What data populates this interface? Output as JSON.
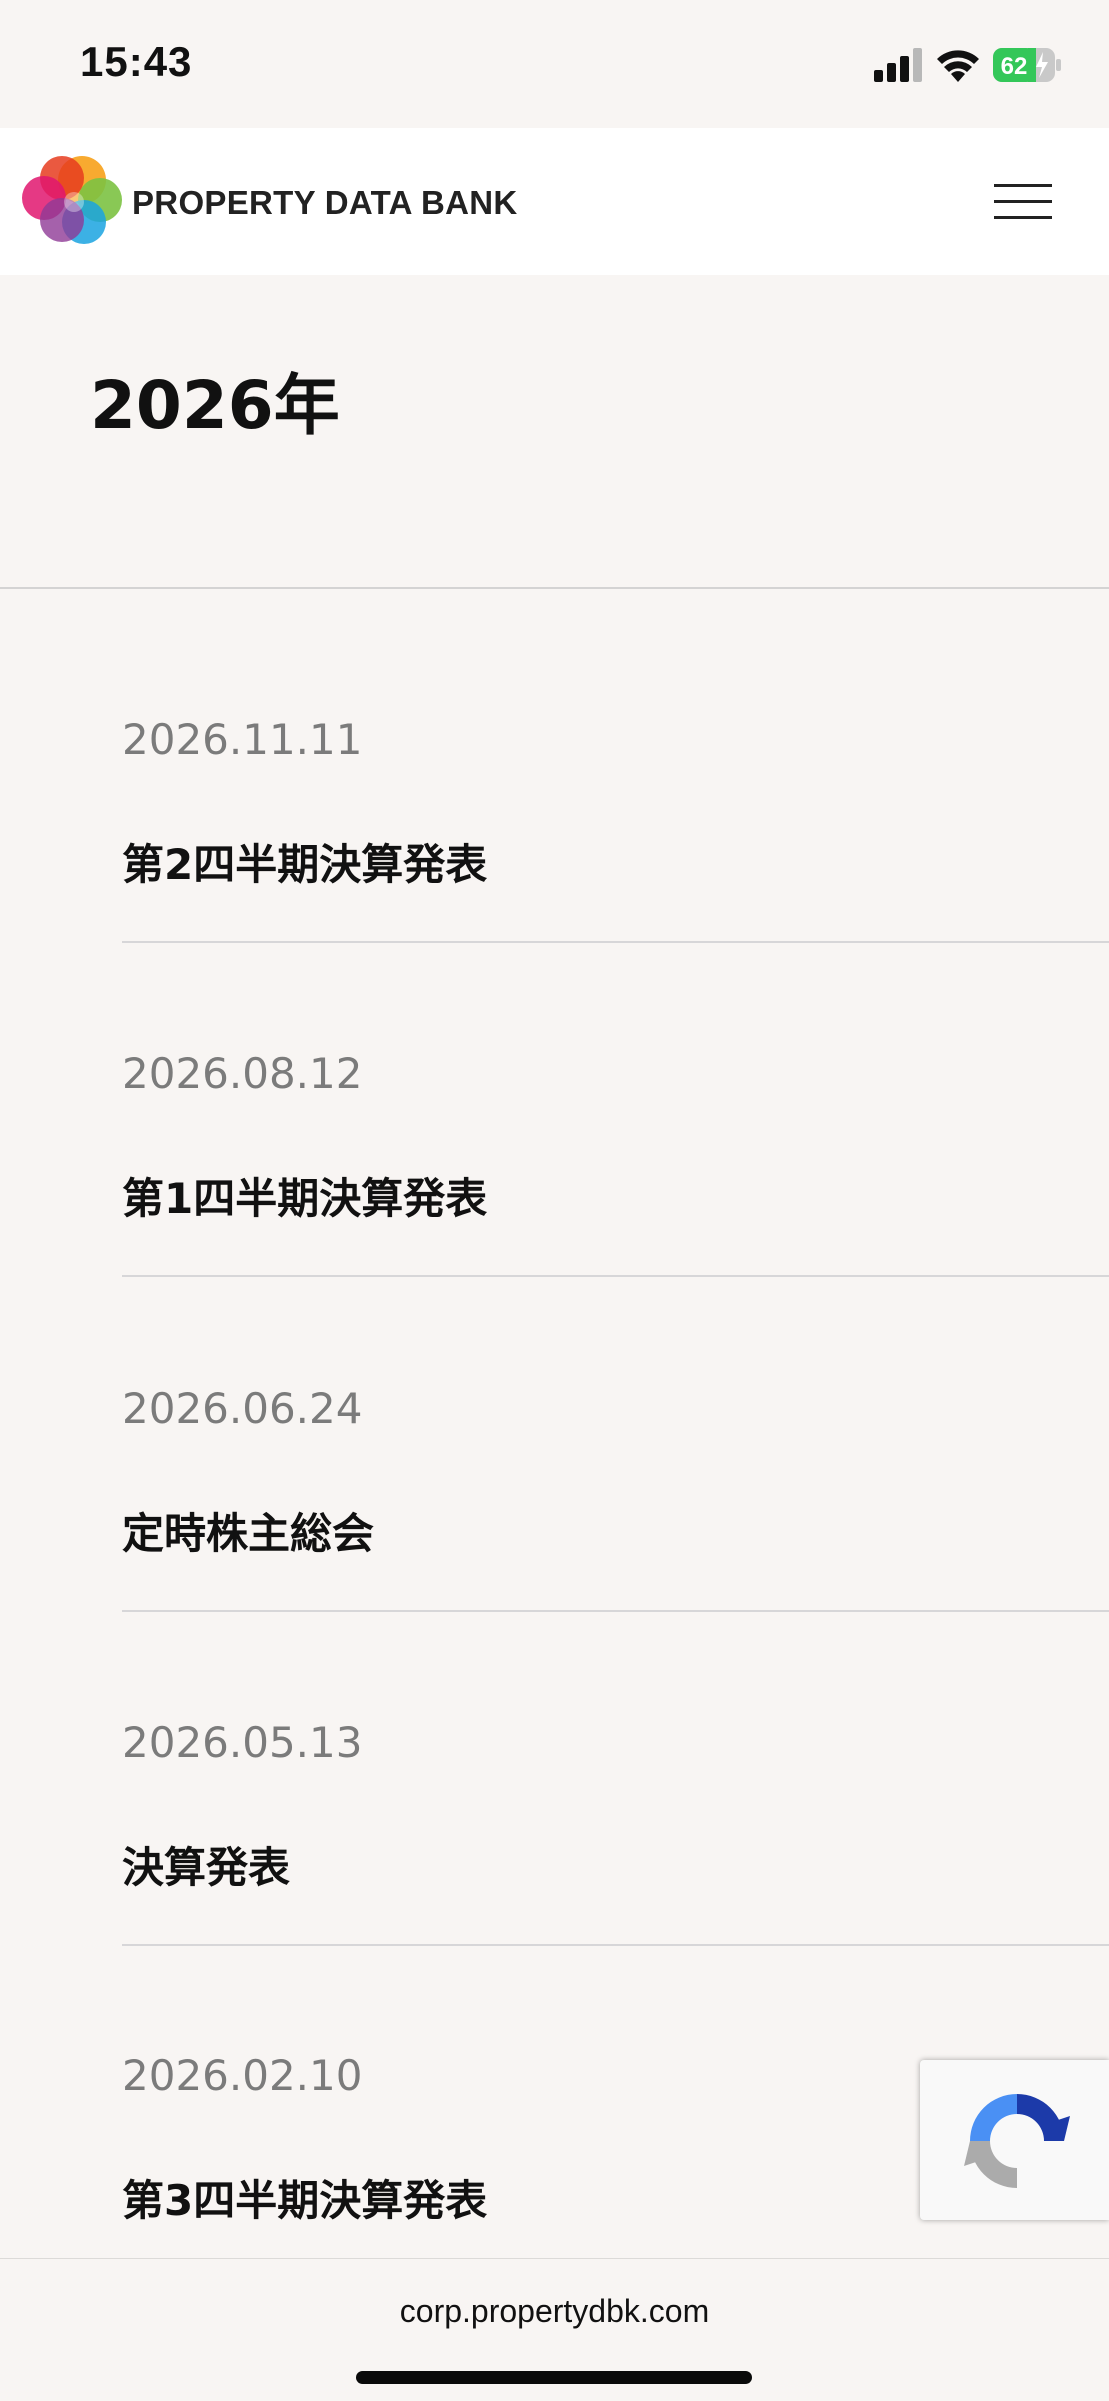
{
  "status_bar": {
    "time": "15:43",
    "battery_level": "62",
    "icons": [
      "signal-icon",
      "wifi-icon",
      "battery-charging-icon"
    ]
  },
  "header": {
    "logo_text": "PROPERTY DATA BANK",
    "logo_icon": "overlapping-color-circles-logo",
    "menu_icon": "hamburger-menu-icon"
  },
  "year_section": {
    "heading": "2026年"
  },
  "events": [
    {
      "date": "2026.11.11",
      "title": "第2四半期決算発表"
    },
    {
      "date": "2026.08.12",
      "title": "第1四半期決算発表"
    },
    {
      "date": "2026.06.24",
      "title": "定時株主総会"
    },
    {
      "date": "2026.05.13",
      "title": "決算発表"
    },
    {
      "date": "2026.02.10",
      "title": "第3四半期決算発表"
    }
  ],
  "browser": {
    "url": "corp.propertydbk.com"
  },
  "recaptcha": {
    "icon": "recaptcha-icon"
  },
  "colors": {
    "background": "#f8f5f3",
    "header_background": "#ffffff",
    "date_text": "#7b7b7b",
    "title_text": "#111111",
    "divider": "#d7d6d8",
    "battery_green": "#34c759"
  }
}
